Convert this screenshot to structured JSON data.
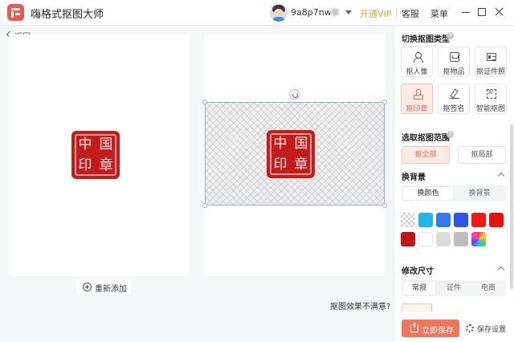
{
  "app": {
    "title": "嗨格式抠图大师"
  },
  "header": {
    "username": "9a8p7nw",
    "open_vip": "开通VIP",
    "service": "客服",
    "menu": "菜单"
  },
  "nav": {
    "back_label": "返回"
  },
  "canvas": {
    "seal_chars": [
      "中",
      "国",
      "印",
      "章"
    ],
    "add_label": "重新添加",
    "unsatisfied_label": "抠图效果不满意?"
  },
  "sidebar": {
    "section_type_title": "切换抠图类型",
    "types": [
      {
        "label": "抠人像",
        "icon": "person-icon"
      },
      {
        "label": "抠物品",
        "icon": "box-icon"
      },
      {
        "label": "抠证件照",
        "icon": "id-card-icon"
      },
      {
        "label": "抠印章",
        "icon": "stamp-icon",
        "active": true
      },
      {
        "label": "抠签名",
        "icon": "signature-icon"
      },
      {
        "label": "智能抠图",
        "icon": "ai-icon"
      }
    ],
    "section_range_title": "选取抠图范围",
    "range_all": "抠全部",
    "range_partial": "抠局部",
    "section_bg_title": "换背景",
    "bg_tabs": [
      "换颜色",
      "换背景"
    ],
    "colors": [
      "transparent",
      "#1fb5e8",
      "#2f7bf3",
      "#2f54eb",
      "#f01818",
      "#e80f0f",
      "#c41414",
      "#ffffff",
      "#dcdcdc",
      "#bdbdbd",
      "rainbow"
    ],
    "section_size_title": "修改尺寸",
    "size_tabs": [
      "常规",
      "证件",
      "电商"
    ],
    "save_label": "立即保存",
    "settings_label": "保存设置"
  }
}
